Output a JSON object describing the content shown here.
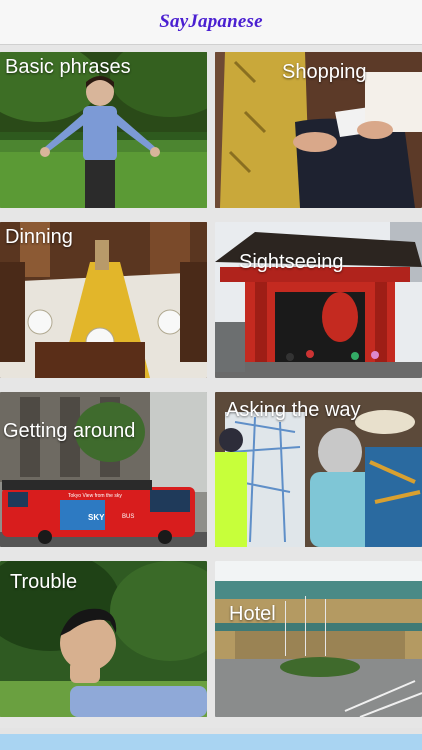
{
  "header": {
    "title": "SayJapanese"
  },
  "categories": [
    {
      "label": "Basic phrases"
    },
    {
      "label": "Shopping"
    },
    {
      "label": "Dinning"
    },
    {
      "label": "Sightseeing"
    },
    {
      "label": "Getting around"
    },
    {
      "label": "Asking the way"
    },
    {
      "label": "Trouble"
    },
    {
      "label": "Hotel"
    }
  ],
  "photo_texts": {
    "bus_sign": "Tokyo View from the sky",
    "bus_logo": "SKY",
    "bus_word": "BUS"
  }
}
